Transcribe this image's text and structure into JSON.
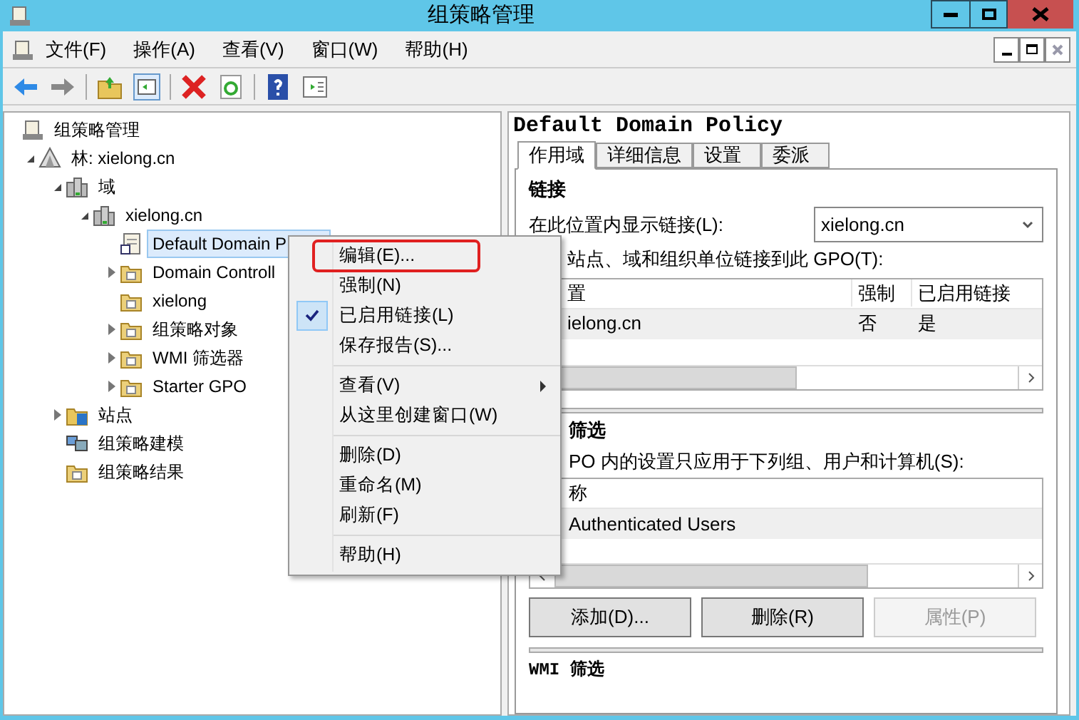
{
  "window": {
    "title": "组策略管理"
  },
  "menu_bar": [
    "文件(F)",
    "操作(A)",
    "查看(V)",
    "窗口(W)",
    "帮助(H)"
  ],
  "tree": [
    {
      "label": "组策略管理",
      "kind": "console",
      "selected": false,
      "children": [
        {
          "label": "林: xielong.cn",
          "kind": "forest",
          "selected": false,
          "expanded": true,
          "children": [
            {
              "label": "域",
              "kind": "domains",
              "selected": false,
              "expanded": true,
              "children": [
                {
                  "label": "xielong.cn",
                  "kind": "domain",
                  "selected": false,
                  "expanded": true,
                  "children": [
                    {
                      "label": "Default Domain P",
                      "kind": "gpo-link",
                      "selected": true
                    },
                    {
                      "label": "Domain Controll",
                      "kind": "ou",
                      "selected": false,
                      "expanded": false
                    },
                    {
                      "label": "xielong",
                      "kind": "ou",
                      "selected": false
                    },
                    {
                      "label": "组策略对象",
                      "kind": "gpo-folder",
                      "selected": false,
                      "expanded": false
                    },
                    {
                      "label": "WMI 筛选器",
                      "kind": "filter",
                      "selected": false,
                      "expanded": false
                    },
                    {
                      "label": "Starter GPO",
                      "kind": "starter",
                      "selected": false,
                      "expanded": false
                    }
                  ]
                }
              ]
            },
            {
              "label": "站点",
              "kind": "sites",
              "selected": false,
              "expanded": false
            },
            {
              "label": "组策略建模",
              "kind": "modeling",
              "selected": false
            },
            {
              "label": "组策略结果",
              "kind": "results",
              "selected": false
            }
          ]
        }
      ]
    }
  ],
  "context_menu": [
    [
      {
        "label": "编辑(E)...",
        "checked": false,
        "outlined": true,
        "submenu": false
      },
      {
        "label": "强制(N)",
        "checked": false,
        "outlined": false,
        "submenu": false
      },
      {
        "label": "已启用链接(L)",
        "checked": true,
        "outlined": false,
        "submenu": false
      },
      {
        "label": "保存报告(S)...",
        "checked": false,
        "outlined": false,
        "submenu": false
      }
    ],
    [
      {
        "label": "查看(V)",
        "checked": false,
        "outlined": false,
        "submenu": true
      },
      {
        "label": "从这里创建窗口(W)",
        "checked": false,
        "outlined": false,
        "submenu": false
      }
    ],
    [
      {
        "label": "删除(D)",
        "checked": false,
        "outlined": false,
        "submenu": false
      },
      {
        "label": "重命名(M)",
        "checked": false,
        "outlined": false,
        "submenu": false
      },
      {
        "label": "刷新(F)",
        "checked": false,
        "outlined": false,
        "submenu": false
      }
    ],
    [
      {
        "label": "帮助(H)",
        "checked": false,
        "outlined": false,
        "submenu": false
      }
    ]
  ],
  "details": {
    "title": "Default Domain Policy",
    "tabs": [
      {
        "label": "作用域",
        "selected": true
      },
      {
        "label": "详细信息",
        "selected": false
      },
      {
        "label": "设置",
        "selected": false
      },
      {
        "label": "委派",
        "selected": false
      }
    ],
    "links": {
      "heading": "链接",
      "location_label": "在此位置内显示链接(L):",
      "location_value": "xielong.cn",
      "list_label": "站点、域和组织单位链接到此 GPO(T):",
      "columns": [
        "置",
        "强制",
        "已启用链接"
      ],
      "rows": [
        [
          "ielong.cn",
          "否",
          "是"
        ]
      ]
    },
    "security": {
      "heading": "筛选",
      "list_label": "PO 内的设置只应用于下列组、用户和计算机(S):",
      "columns": [
        "称"
      ],
      "rows": [
        [
          "Authenticated Users"
        ]
      ],
      "buttons": [
        {
          "label": "添加(D)...",
          "disabled": false
        },
        {
          "label": "删除(R)",
          "disabled": false
        },
        {
          "label": "属性(P)",
          "disabled": true
        }
      ]
    },
    "wmi_heading": "WMI 筛选"
  }
}
